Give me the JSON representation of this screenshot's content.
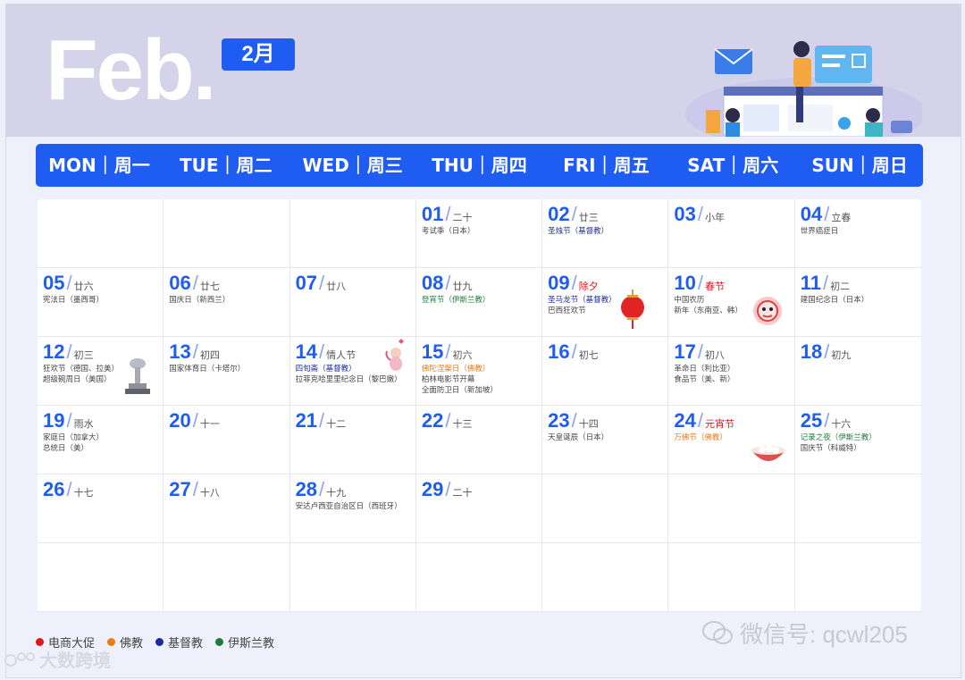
{
  "header": {
    "month_en": "Feb.",
    "month_cn": "2月"
  },
  "weekdays": [
    "MON｜周一",
    "TUE｜周二",
    "WED｜周三",
    "THU｜周四",
    "FRI｜周五",
    "SAT｜周六",
    "SUN｜周日"
  ],
  "days": [
    {
      "num": "",
      "lunar": "",
      "events": []
    },
    {
      "num": "",
      "lunar": "",
      "events": []
    },
    {
      "num": "",
      "lunar": "",
      "events": []
    },
    {
      "num": "01",
      "lunar": "二十",
      "events": [
        {
          "text": "考试季（日本）",
          "type": "none"
        }
      ]
    },
    {
      "num": "02",
      "lunar": "廿三",
      "events": [
        {
          "text": "圣烛节（基督教）",
          "type": "christian"
        }
      ]
    },
    {
      "num": "03",
      "lunar": "小年",
      "events": []
    },
    {
      "num": "04",
      "lunar": "立春",
      "events": [
        {
          "text": "世界癌症日",
          "type": "none"
        }
      ]
    },
    {
      "num": "05",
      "lunar": "廿六",
      "events": [
        {
          "text": "宪法日（墨西哥）",
          "type": "none"
        }
      ]
    },
    {
      "num": "06",
      "lunar": "廿七",
      "events": [
        {
          "text": "国庆日（新西兰）",
          "type": "none"
        }
      ]
    },
    {
      "num": "07",
      "lunar": "廿八",
      "events": []
    },
    {
      "num": "08",
      "lunar": "廿九",
      "events": [
        {
          "text": "登宵节（伊斯兰教）",
          "type": "islam"
        }
      ]
    },
    {
      "num": "09",
      "lunar": "除夕",
      "lunar_red": true,
      "events": [
        {
          "text": "圣马龙节（基督教）",
          "type": "christian"
        },
        {
          "text": "巴西狂欢节",
          "type": "none"
        }
      ],
      "deco": "lantern-icon"
    },
    {
      "num": "10",
      "lunar": "春节",
      "lunar_red": true,
      "events": [
        {
          "text": "中国农历",
          "type": "none"
        },
        {
          "text": "新年（东南亚、韩）",
          "type": "none"
        }
      ],
      "deco": "dragon-icon"
    },
    {
      "num": "11",
      "lunar": "初二",
      "events": [
        {
          "text": "建国纪念日（日本）",
          "type": "none"
        }
      ]
    },
    {
      "num": "12",
      "lunar": "初三",
      "events": [
        {
          "text": "狂欢节（德国、拉美）",
          "type": "none"
        },
        {
          "text": "超级碗周日（美国）",
          "type": "none"
        }
      ],
      "deco": "trophy-icon"
    },
    {
      "num": "13",
      "lunar": "初四",
      "events": [
        {
          "text": "国家体育日（卡塔尔）",
          "type": "none"
        }
      ]
    },
    {
      "num": "14",
      "lunar": "情人节",
      "events": [
        {
          "text": "四旬斋（基督教）",
          "type": "christian"
        },
        {
          "text": "拉菲克哈里里纪念日（黎巴嫩）",
          "type": "none"
        }
      ],
      "deco": "cupid-icon"
    },
    {
      "num": "15",
      "lunar": "初六",
      "events": [
        {
          "text": "佛陀涅槃日（佛教）",
          "type": "buddhist"
        },
        {
          "text": "柏林电影节开幕",
          "type": "none"
        },
        {
          "text": "全面防卫日（新加坡）",
          "type": "none"
        }
      ]
    },
    {
      "num": "16",
      "lunar": "初七",
      "events": []
    },
    {
      "num": "17",
      "lunar": "初八",
      "events": [
        {
          "text": "革命日（利比亚）",
          "type": "none"
        },
        {
          "text": "食品节（美、新）",
          "type": "none"
        }
      ]
    },
    {
      "num": "18",
      "lunar": "初九",
      "events": []
    },
    {
      "num": "19",
      "lunar": "雨水",
      "events": [
        {
          "text": "家庭日（加拿大）",
          "type": "none"
        },
        {
          "text": "总统日（美）",
          "type": "none"
        }
      ]
    },
    {
      "num": "20",
      "lunar": "十一",
      "events": []
    },
    {
      "num": "21",
      "lunar": "十二",
      "events": []
    },
    {
      "num": "22",
      "lunar": "十三",
      "events": []
    },
    {
      "num": "23",
      "lunar": "十四",
      "events": [
        {
          "text": "天皇诞辰（日本）",
          "type": "none"
        }
      ]
    },
    {
      "num": "24",
      "lunar": "元宵节",
      "lunar_red": true,
      "events": [
        {
          "text": "万佛节（佛教）",
          "type": "buddhist"
        }
      ],
      "deco": "tangyuan-icon"
    },
    {
      "num": "25",
      "lunar": "十六",
      "events": [
        {
          "text": "记录之夜（伊斯兰教）",
          "type": "islam"
        },
        {
          "text": "国庆节（科威特）",
          "type": "none"
        }
      ]
    },
    {
      "num": "26",
      "lunar": "十七",
      "events": []
    },
    {
      "num": "27",
      "lunar": "十八",
      "events": []
    },
    {
      "num": "28",
      "lunar": "十九",
      "events": [
        {
          "text": "安达卢西亚自治区日（西班牙）",
          "type": "none"
        }
      ]
    },
    {
      "num": "29",
      "lunar": "二十",
      "events": []
    },
    {
      "num": "",
      "lunar": "",
      "events": []
    },
    {
      "num": "",
      "lunar": "",
      "events": []
    },
    {
      "num": "",
      "lunar": "",
      "events": []
    },
    {
      "num": "",
      "lunar": "",
      "events": []
    },
    {
      "num": "",
      "lunar": "",
      "events": []
    },
    {
      "num": "",
      "lunar": "",
      "events": []
    },
    {
      "num": "",
      "lunar": "",
      "events": []
    },
    {
      "num": "",
      "lunar": "",
      "events": []
    },
    {
      "num": "",
      "lunar": "",
      "events": []
    },
    {
      "num": "",
      "lunar": "",
      "events": []
    }
  ],
  "legend": [
    {
      "label": "电商大促",
      "color": "#e3131b"
    },
    {
      "label": "佛教",
      "color": "#ee7a16"
    },
    {
      "label": "基督教",
      "color": "#1c2aa0"
    },
    {
      "label": "伊斯兰教",
      "color": "#1e7d3a"
    }
  ],
  "watermark": {
    "wechat": "微信号: qcwl205",
    "brand": "大数跨境"
  }
}
